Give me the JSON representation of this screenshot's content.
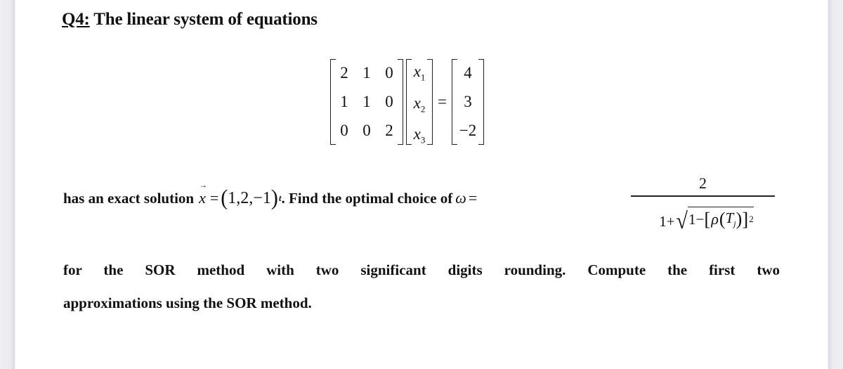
{
  "question": {
    "number": "Q4:",
    "title": "The linear system of equations"
  },
  "system": {
    "matrix_A": [
      [
        "2",
        "1",
        "0"
      ],
      [
        "1",
        "1",
        "0"
      ],
      [
        "0",
        "0",
        "2"
      ]
    ],
    "unknowns": [
      {
        "base": "x",
        "sub": "1"
      },
      {
        "base": "x",
        "sub": "2"
      },
      {
        "base": "x",
        "sub": "3"
      }
    ],
    "equals": "=",
    "vector_b": [
      "4",
      "3",
      "−2"
    ]
  },
  "line2": {
    "prefix": "has an exact solution",
    "vector_var": "x",
    "equals": "=",
    "solution_open": "(",
    "solution_values": "1,2,−1",
    "solution_close": ")",
    "transpose": "t",
    "after": ". Find the optimal choice of",
    "omega": "ω",
    "omega_eq": "="
  },
  "omega_formula": {
    "numerator": "2",
    "denominator_one": "1+",
    "radicand_one": "1−",
    "lbracket": "[",
    "rho": "ρ",
    "lparen": "(",
    "T": "T",
    "T_sub": "j",
    "rparen": ")",
    "rbracket": "]",
    "exponent": "2"
  },
  "line3": "for the SOR method with two significant digits rounding. Compute the first two",
  "line4": "approximations using the SOR method."
}
